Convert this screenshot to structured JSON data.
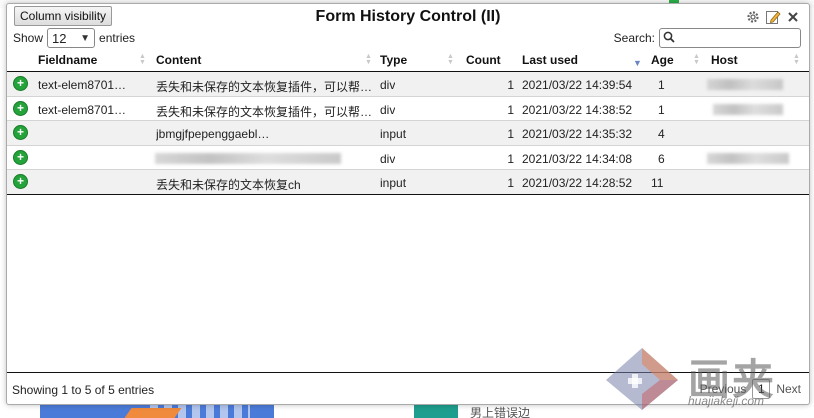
{
  "popup": {
    "title": "Form History Control (II)",
    "column_visibility_label": "Column visibility"
  },
  "icons": {
    "settings": "gear-icon",
    "edit": "edit-icon",
    "close": "close-icon"
  },
  "length": {
    "show_label": "Show",
    "value": "12",
    "entries_label": "entries"
  },
  "search": {
    "label": "Search:",
    "value": ""
  },
  "columns": {
    "fieldname": "Fieldname",
    "content": "Content",
    "type": "Type",
    "count": "Count",
    "last_used": "Last used",
    "age": "Age",
    "host": "Host"
  },
  "sorted_column": "last_used",
  "rows": [
    {
      "fieldname": "text-elem8701…",
      "content": "丢失和未保存的文本恢复插件，可以帮…",
      "type": "div",
      "count": "1",
      "last_used": "2021/03/22 14:39:54",
      "age": "1",
      "host_blurred": true
    },
    {
      "fieldname": "text-elem8701…",
      "content": "丢失和未保存的文本恢复插件，可以帮…",
      "type": "div",
      "count": "1",
      "last_used": "2021/03/22 14:38:52",
      "age": "1",
      "host_blurred": true
    },
    {
      "fieldname": "",
      "content": "jbmgjfpepenggaebl…",
      "type": "input",
      "count": "1",
      "last_used": "2021/03/22 14:35:32",
      "age": "4",
      "host_blurred": false
    },
    {
      "fieldname": "",
      "content": "",
      "content_blurred": true,
      "type": "div",
      "count": "1",
      "last_used": "2021/03/22 14:34:08",
      "age": "6",
      "host_blurred": true
    },
    {
      "fieldname": "",
      "content": "丢失和未保存的文本恢复ch",
      "type": "input",
      "count": "1",
      "last_used": "2021/03/22 14:28:52",
      "age": "11",
      "host_blurred": false
    }
  ],
  "footer": {
    "info": "Showing 1 to 5 of 5 entries",
    "previous": "Previous",
    "page": "1",
    "next": "Next"
  },
  "watermark": {
    "text": "画夹",
    "url": "huajiakeji.com"
  },
  "background": {
    "text": "男上错误边"
  },
  "colors": {
    "add_icon": "#24a33a",
    "sort_active": "#6b86c7",
    "row_odd": "#f1f1f1"
  }
}
